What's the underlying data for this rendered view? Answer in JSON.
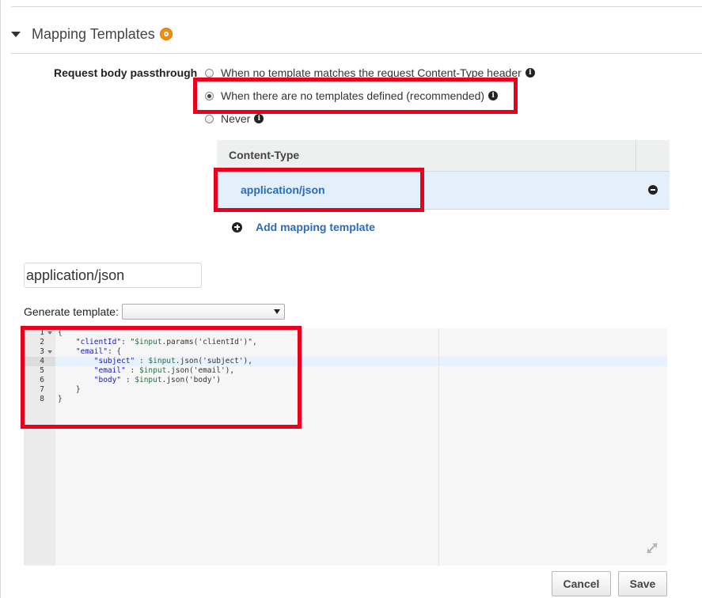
{
  "section": {
    "title": "Mapping Templates"
  },
  "passthrough": {
    "label": "Request body passthrough",
    "options": [
      {
        "label": "When no template matches the request Content-Type header",
        "selected": false
      },
      {
        "label": "When there are no templates defined (recommended)",
        "selected": true
      },
      {
        "label": "Never",
        "selected": false
      }
    ]
  },
  "content_type_table": {
    "header": "Content-Type",
    "rows": [
      {
        "label": "application/json",
        "selected": true
      }
    ],
    "add_label": "Add mapping template"
  },
  "template_editor": {
    "content_type_value": "application/json",
    "generate_label": "Generate template:",
    "generate_selected": "",
    "line_numbers": [
      "1",
      "2",
      "3",
      "4",
      "5",
      "6",
      "7",
      "8"
    ],
    "active_line": 4,
    "lines": [
      "{",
      "    \"clientId\": \"$input.params('clientId')\",",
      "    \"email\": {",
      "        \"subject\" : $input.json('subject'),",
      "        \"email\" : $input.json('email'),",
      "        \"body\" : $input.json('body')",
      "    }",
      "}"
    ]
  },
  "buttons": {
    "cancel": "Cancel",
    "save": "Save"
  },
  "colors": {
    "link": "#2a6cb8",
    "highlight": "#e8001c",
    "selected_row": "#e3effa",
    "status_dot": "#f08d0f"
  },
  "icons": [
    "caret-down-icon",
    "status-dot-icon",
    "info-icon",
    "minus-circle-icon",
    "plus-circle-icon",
    "expand-icon"
  ]
}
